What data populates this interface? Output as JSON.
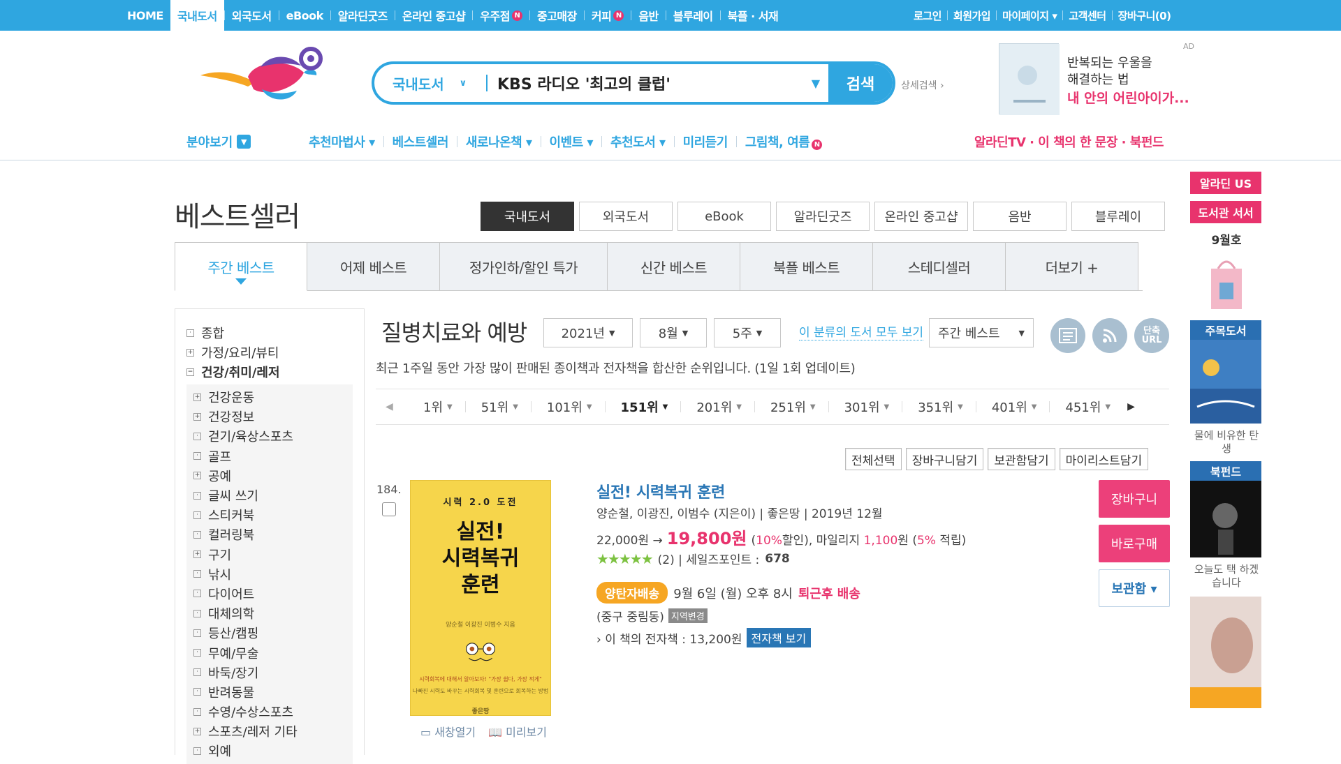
{
  "gnb": {
    "items": [
      {
        "label": "HOME",
        "badge": ""
      },
      {
        "label": "국내도서",
        "badge": ""
      },
      {
        "label": "외국도서",
        "badge": ""
      },
      {
        "label": "eBook",
        "badge": ""
      },
      {
        "label": "알라딘굿즈",
        "badge": ""
      },
      {
        "label": "온라인 중고샵",
        "badge": ""
      },
      {
        "label": "우주점",
        "badge": "N"
      },
      {
        "label": "중고매장",
        "badge": ""
      },
      {
        "label": "커피",
        "badge": "N"
      },
      {
        "label": "음반",
        "badge": ""
      },
      {
        "label": "블루레이",
        "badge": ""
      },
      {
        "label": "북플 · 서재",
        "badge": ""
      }
    ],
    "right": [
      "로그인",
      "회원가입",
      "마이페이지 ▾",
      "고객센터",
      "장바구니(0)"
    ]
  },
  "search": {
    "category": "국내도서",
    "value": "KBS 라디오 '최고의 클럽'",
    "button": "검색",
    "advanced": "상세검색 ›"
  },
  "ad": {
    "label": "AD",
    "line1": "반복되는 우울을",
    "line2": "해결하는 법",
    "line3": "내 안의 어린아이가..."
  },
  "lnb": {
    "category": "분야보기",
    "items": [
      "추천마법사 ▾",
      "베스트셀러",
      "새로나온책 ▾",
      "이벤트 ▾",
      "추천도서 ▾",
      "미리듣기",
      "그림책, 여름"
    ],
    "items_badge": "N",
    "right": "알라딘TV · 이 책의 한 문장 · 북펀드"
  },
  "page": {
    "title": "베스트셀러",
    "mall_tabs": [
      "국내도서",
      "외국도서",
      "eBook",
      "알라딘굿즈",
      "온라인 중고샵",
      "음반",
      "블루레이"
    ],
    "best_tabs": [
      "주간 베스트",
      "어제 베스트",
      "정가인하/할인 특가",
      "신간 베스트",
      "북플 베스트",
      "스테디셀러",
      "더보기 +"
    ]
  },
  "sidebar": {
    "top": [
      {
        "icon": "·",
        "label": "종합"
      },
      {
        "icon": "+",
        "label": "가정/요리/뷰티"
      },
      {
        "icon": "−",
        "label": "건강/취미/레저"
      }
    ],
    "sub": [
      {
        "icon": "+",
        "label": "건강운동"
      },
      {
        "icon": "+",
        "label": "건강정보"
      },
      {
        "icon": "·",
        "label": "걷기/육상스포츠"
      },
      {
        "icon": "·",
        "label": "골프"
      },
      {
        "icon": "+",
        "label": "공예"
      },
      {
        "icon": "·",
        "label": "글씨 쓰기"
      },
      {
        "icon": "·",
        "label": "스티커북"
      },
      {
        "icon": "·",
        "label": "컬러링북"
      },
      {
        "icon": "+",
        "label": "구기"
      },
      {
        "icon": "·",
        "label": "낚시"
      },
      {
        "icon": "·",
        "label": "다이어트"
      },
      {
        "icon": "·",
        "label": "대체의학"
      },
      {
        "icon": "·",
        "label": "등산/캠핑"
      },
      {
        "icon": "·",
        "label": "무예/무술"
      },
      {
        "icon": "·",
        "label": "바둑/장기"
      },
      {
        "icon": "·",
        "label": "반려동물"
      },
      {
        "icon": "·",
        "label": "수영/수상스포츠"
      },
      {
        "icon": "+",
        "label": "스포츠/레저 기타"
      },
      {
        "icon": "·",
        "label": "외예"
      }
    ]
  },
  "content": {
    "category_title": "질병치료와 예방",
    "year": "2021년",
    "month": "8월",
    "week": "5주",
    "all_link": "이 분류의 도서 모두 보기",
    "period": "주간 베스트",
    "icon_btns": [
      "",
      "",
      "단축 URL"
    ],
    "description": "최근 1주일 동안 가장 많이 판매된 종이책과 전자책을 합산한 순위입니다. (1일 1회 업데이트)",
    "pages": [
      "1위",
      "51위",
      "101위",
      "151위",
      "201위",
      "251위",
      "301위",
      "351위",
      "401위",
      "451위"
    ],
    "active_page": "151위",
    "tools": [
      "전체선택",
      "장바구니담기",
      "보관함담기",
      "마이리스트담기"
    ]
  },
  "book": {
    "rank": "184.",
    "cover": {
      "top": "시력 2.0 도전",
      "title_line1": "실전!",
      "title_line2": "시력복귀",
      "title_line3": "훈련",
      "authors": "양순철 이광진 이범수 지음",
      "blurb1": "시력회복에 대해서 알아보자! \"가장 쉽다, 가장 적게\"",
      "blurb2": "나빠진 시력도 바꾸는 시력회복 및 훈련으로 회복하는 방법",
      "publisher": "좋은땅"
    },
    "links": [
      "새창열기",
      "미리보기"
    ],
    "title": "실전! 시력복귀 훈련",
    "meta": "양순철, 이광진, 이범수 (지은이) | 좋은땅 | 2019년 12월",
    "price_orig": "22,000원 →",
    "price_sale": "19,800원",
    "discount_open": "(",
    "discount": "10%",
    "discount_text": "할인), 마일리지",
    "mileage": "1,100",
    "mileage_text": "원 (",
    "mileage_rate": "5%",
    "mileage_end": "적립)",
    "stars": "★★★★★",
    "rating_text": "(2) | 세일즈포인트 :",
    "sales_point": "678",
    "delivery_badge": "양탄자배송",
    "delivery_time": "9월 6일 (월) 오후 8시",
    "delivery_red": "퇴근후 배송",
    "area": "(중구 중림동)",
    "area_btn": "지역변경",
    "ebook_text": "› 이 책의 전자책 : 13,200원",
    "ebook_btn": "전자책 보기",
    "btn_cart": "장바구니",
    "btn_buy": "바로구매",
    "btn_save": "보관함 ▾"
  },
  "right_side": {
    "btn1": "알라딘 US",
    "btn2": "도서관 서서",
    "month": "9월호",
    "label1": "주목도서",
    "cap1": "물에 비유한 탄생",
    "label2": "북펀드",
    "cap2": "오늘도 택 하겠습니다"
  },
  "colors": {
    "brand": "#2fa6e0",
    "pink": "#e8336d",
    "link": "#2976b5"
  }
}
